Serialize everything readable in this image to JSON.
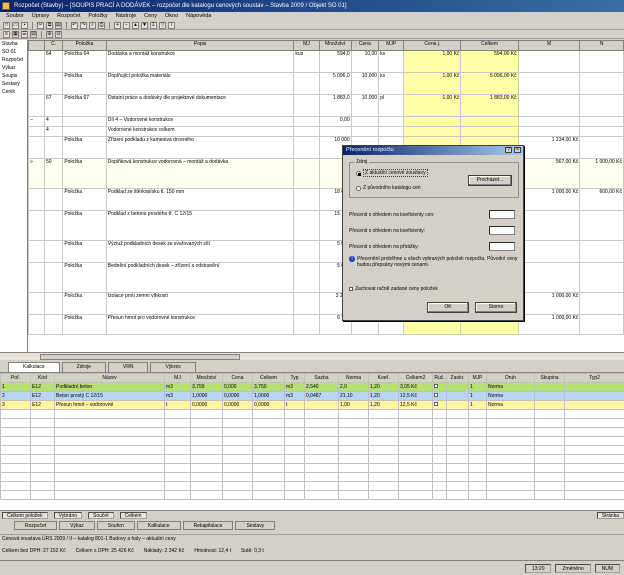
{
  "window": {
    "title": "Rozpočet (Stavby) – [SOUPIS PRACÍ A DODÁVEK – rozpočet dle katalogu cenových soustav – Stavba 2009 / Objekt SO 01]"
  },
  "menu": [
    "Soubor",
    "Úpravy",
    "Rozpočet",
    "Položky",
    "Nástroje",
    "Ceny",
    "Okno",
    "Nápověda"
  ],
  "left_items": [
    "Stavba",
    "SO 01",
    "Rozpočet",
    "Výkaz",
    "Soupis",
    "Sestavy",
    "Ceník"
  ],
  "main_grid": {
    "columns": [
      "",
      "Č.",
      "Položka",
      "Popis",
      "MJ",
      "Množství",
      "Cena",
      "MJP",
      "Cena j.",
      "Celkem",
      "M",
      "N"
    ],
    "rows": [
      {
        "c": "",
        "n": "64",
        "pol": "Položka 64",
        "desc": "Dodávka a montáž konstrukce",
        "mj": "kus",
        "q": "594,0",
        "p": "10,00",
        "mjp": "ks",
        "cj": "1,00 Kč",
        "cel": "594,00 Kč",
        "m": "",
        "nn": "",
        "h": 22
      },
      {
        "c": "",
        "n": "",
        "pol": "Položka",
        "desc": "Doplňující položka materiálu",
        "mj": "",
        "q": "5 096,0",
        "p": "10,000",
        "mjp": "ks",
        "cj": "1,00 Kč",
        "cel": "5 096,00 Kč",
        "m": "",
        "nn": "",
        "h": 22
      },
      {
        "c": "",
        "n": "67",
        "pol": "Položka 67",
        "desc": "Ostatní práce a dodávky dle projektové dokumentace",
        "mj": "",
        "q": "1 883,0",
        "p": "10,000",
        "mjp": "pl",
        "cj": "1,00 Kč",
        "cel": "1 883,00 Kč",
        "m": "",
        "nn": "",
        "h": 22
      },
      {
        "c": "–",
        "n": "4",
        "pol": "",
        "desc": "Díl 4 – Vodorovné konstrukce",
        "mj": "",
        "q": "0,00",
        "p": "",
        "mjp": "",
        "cj": "",
        "cel": "",
        "m": "",
        "nn": "",
        "h": 10
      },
      {
        "c": "",
        "n": "4",
        "pol": "",
        "desc": "Vodorovné konstrukce celkem",
        "mj": "",
        "q": "",
        "p": "",
        "mjp": "",
        "cj": "",
        "cel": "",
        "m": "",
        "nn": "",
        "h": 10
      },
      {
        "c": "",
        "n": "",
        "pol": "Položka",
        "desc": "Zřízení podkladu z kameniva drceného",
        "mj": "",
        "q": "10 000",
        "p": "",
        "mjp": "",
        "cj": "",
        "cel": "",
        "m": "1 234,00 Kč",
        "nn": "",
        "h": 22
      },
      {
        "c": "»",
        "n": "50",
        "pol": "Položka",
        "desc": "Doplňková konstrukce vodorovná – montáž a dodávka",
        "mj": "",
        "q": "7,0",
        "p": "",
        "mjp": "",
        "cj": "",
        "cel": "",
        "m": "567,00 Kč",
        "nn": "1 000,00 Kč",
        "h": 30,
        "sel": true
      },
      {
        "c": "",
        "n": "",
        "pol": "Položka",
        "desc": "Podklad ze štěrkopísku tl. 150 mm",
        "mj": "",
        "q": "18 000",
        "p": "",
        "mjp": "",
        "cj": "",
        "cel": "",
        "m": "1 000,00 Kč",
        "nn": "600,00 Kč",
        "h": 22
      },
      {
        "c": "",
        "n": "",
        "pol": "Položka",
        "desc": "Podklad z betonu prostého tř. C 12/15",
        "mj": "",
        "q": "15 750",
        "p": "",
        "mjp": "",
        "cj": "",
        "cel": "",
        "m": "",
        "nn": "",
        "h": 30
      },
      {
        "c": "",
        "n": "",
        "pol": "Položka",
        "desc": "Výztuž podkladních desek ze svařovaných sítí",
        "mj": "",
        "q": "5 000",
        "p": "",
        "mjp": "",
        "cj": "",
        "cel": "",
        "m": "",
        "nn": "",
        "h": 22
      },
      {
        "c": "",
        "n": "",
        "pol": "Položka",
        "desc": "Bednění podkladních desek – zřízení a odstranění",
        "mj": "",
        "q": "5 000",
        "p": "",
        "mjp": "",
        "cj": "",
        "cel": "",
        "m": "",
        "nn": "",
        "h": 30
      },
      {
        "c": "",
        "n": "",
        "pol": "Položka",
        "desc": "Izolace proti zemní vlhkosti",
        "mj": "",
        "q": "3 2,00",
        "p": "10,000",
        "mjp": "",
        "cj": "1,00 Kč",
        "cel": "",
        "m": "1 000,00 Kč",
        "nn": "",
        "h": 22
      },
      {
        "c": "",
        "n": "",
        "pol": "Položka",
        "desc": "Přesun hmot pro vodorovné konstrukce",
        "mj": "",
        "q": "6 740",
        "p": "10,000",
        "mjp": "",
        "cj": "1,00 Kč",
        "cel": "",
        "m": "1 000,00 Kč",
        "nn": "",
        "h": 20
      }
    ]
  },
  "dialog": {
    "title": "Přecenění rozpočtu",
    "close": "×",
    "help": "?",
    "group_label": "Zdroj",
    "radio1": "Z aktuální cenové soustavy",
    "radio2": "Z původního katalogu cen",
    "browse": "Procházet...",
    "line1": "Přecenit s ohledem na koeficienty cen:",
    "line2": "Přecenit s ohledem na koeficienty:",
    "line3": "Přecenit s ohledem na přirážky:",
    "info": "Přecenění proběhne u všech vybraných položek rozpočtu. Původní ceny budou přepsány novými cenami.",
    "check": "Zachovat ručně zadané ceny položek",
    "ok": "OK",
    "cancel": "Storno"
  },
  "bottom_tabs": [
    "Kalkulace",
    "Zdroje",
    "VRN",
    "Výkres"
  ],
  "lower_grid": {
    "columns": [
      "Poř.",
      "Kód",
      "Název",
      "MJ",
      "Množství",
      "Cena",
      "Celkem",
      "Typ",
      "Sazba",
      "Norma",
      "Koef.",
      "Celkem2",
      "Ruč.",
      "Zaokr.",
      "MJP",
      "Druh",
      "Skupina",
      "Typ2"
    ],
    "rows": [
      {
        "cls": "lr-green",
        "v": [
          "1",
          "E12",
          "Podkladní beton",
          "m3",
          "3,750",
          "0,000",
          "3,750",
          "m3",
          "2,540",
          "2,0",
          "1,20",
          "3,05 Kč",
          "",
          "",
          "1",
          "Norma",
          "",
          ""
        ]
      },
      {
        "cls": "lr-blue",
        "v": [
          "2",
          "E12",
          "Beton prostý C 12/15",
          "m3",
          "1,0000",
          "0,0000",
          "1,0000",
          "m3",
          "0,0487",
          "21,10",
          "1,20",
          "12,5 Kč",
          "",
          "",
          "1",
          "Norma",
          "",
          ""
        ]
      },
      {
        "cls": "lr-yellow",
        "v": [
          "3",
          "E12",
          "Přesun hmot – vodorovné",
          "t",
          "0,0000",
          "0,0000",
          "0,0000",
          "t",
          "",
          "1,00",
          "1,20",
          "12,5 Kč",
          "",
          "",
          "1",
          "Norma",
          "",
          ""
        ]
      }
    ]
  },
  "status1": [
    "Celkem položek",
    "Vybráno",
    "Součet",
    "Celkem",
    "Stránka"
  ],
  "nav_tabs": [
    "Rozpočet",
    "Výkaz",
    "Souhrn",
    "Kalkulace",
    "Rekapitulace",
    "Sestavy"
  ],
  "status2": "Cenová soustava ÚRS 2009 / II – katalog 801-1 Budovy a haly – aktuální ceny",
  "status3": [
    "Celkem bez DPH: 27 152 Kč",
    "Celkem s DPH: 25 426 Kč",
    "Náklady: 2 342 Kč",
    "Hmotnost: 12,4 t",
    "Sutě: 0,3 t"
  ],
  "status4": [
    "13:20",
    "Změněno",
    "NUM"
  ]
}
